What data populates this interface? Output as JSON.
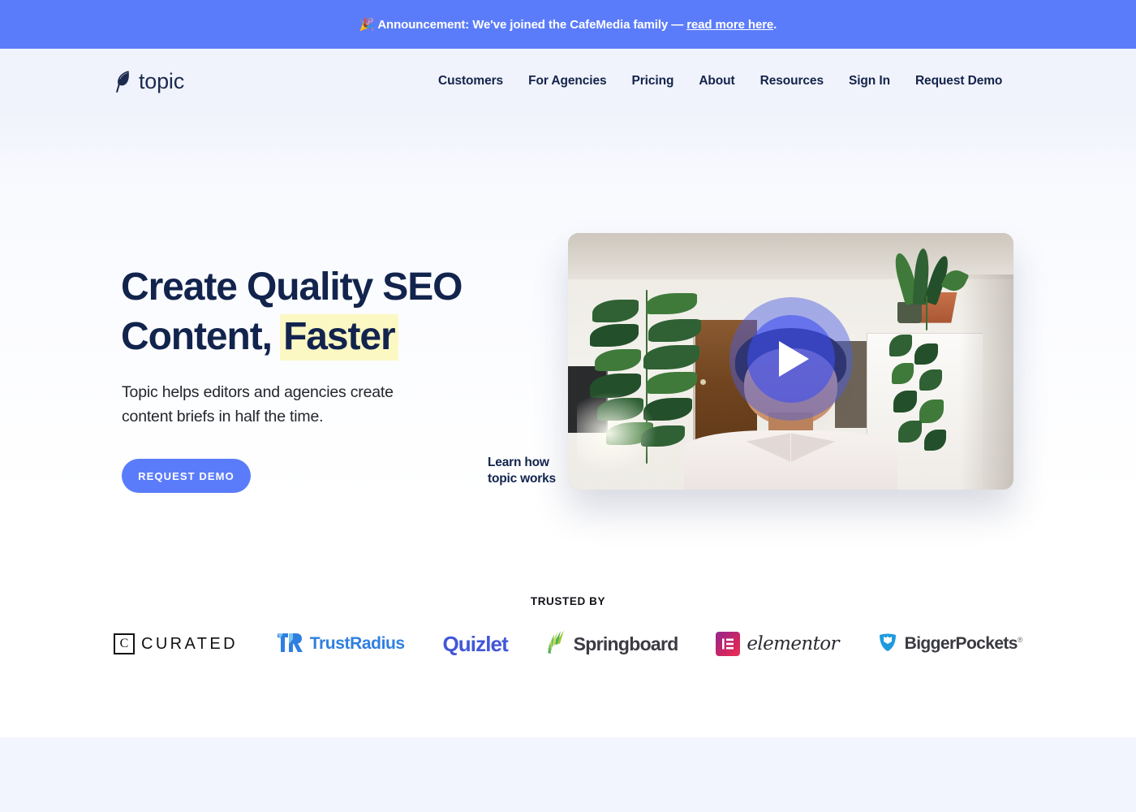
{
  "announcement": {
    "emoji": "🎉",
    "text_before": "Announcement: We've joined the CafeMedia family — ",
    "link_label": "read more here",
    "text_after": "."
  },
  "navbar": {
    "logo": {
      "icon": "feather-icon",
      "text": "topic"
    },
    "links": [
      {
        "label": "Customers"
      },
      {
        "label": "For Agencies"
      },
      {
        "label": "Pricing"
      },
      {
        "label": "About"
      },
      {
        "label": "Resources"
      },
      {
        "label": "Sign In"
      },
      {
        "label": "Request Demo"
      }
    ]
  },
  "hero": {
    "heading_line1": "Create Quality SEO",
    "heading_line2_pre": "Content, ",
    "heading_highlight": "Faster",
    "subheading": "Topic helps editors and agencies create content briefs in half the time.",
    "cta_label": "REQUEST DEMO",
    "video": {
      "play_icon": "play-icon",
      "caption_line1": "Learn how",
      "caption_line2": "topic works"
    }
  },
  "trusted": {
    "label": "TRUSTED BY",
    "brands": [
      {
        "name": "Curated",
        "mark": "C",
        "word": "CURATED"
      },
      {
        "name": "TrustRadius",
        "mark": "TR",
        "word": "TrustRadius"
      },
      {
        "name": "Quizlet",
        "word": "Quizlet"
      },
      {
        "name": "Springboard",
        "word": "Springboard"
      },
      {
        "name": "Elementor",
        "word": "elementor"
      },
      {
        "name": "BiggerPockets",
        "word": "BiggerPockets",
        "registered": "®"
      }
    ]
  },
  "colors": {
    "accent_blue": "#5b7cfa",
    "navy": "#12244d",
    "highlight_yellow": "#fbf8c4",
    "page_bg": "#f3f5fe"
  }
}
